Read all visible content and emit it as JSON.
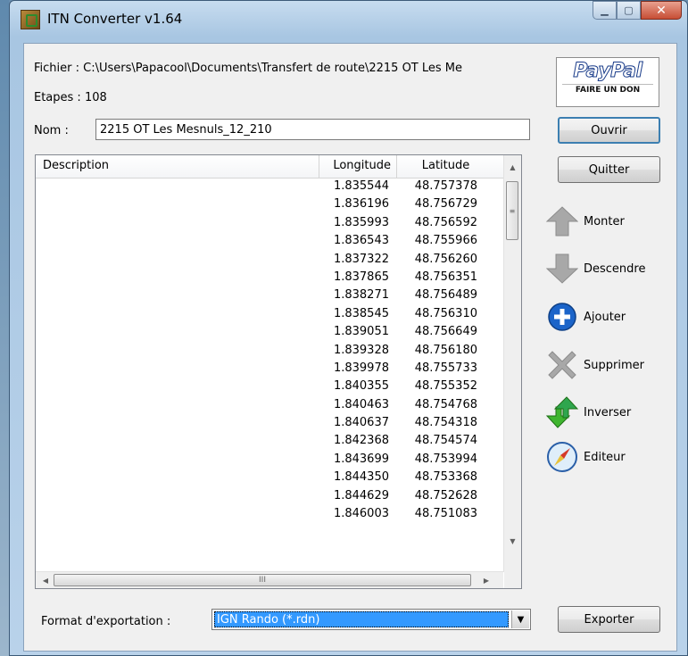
{
  "window": {
    "title": "ITN Converter v1.64"
  },
  "file": {
    "fichier_text": "Fichier : C:\\Users\\Papacool\\Documents\\Transfert de route\\2215 OT Les Me",
    "etapes_text": "Etapes : 108",
    "nom_label": "Nom :",
    "nom_value": "2215 OT Les Mesnuls_12_210"
  },
  "paypal": {
    "logo": "PayPal",
    "don": "FAIRE UN DON"
  },
  "buttons": {
    "ouvrir": "Ouvrir",
    "quitter": "Quitter",
    "monter": "Monter",
    "descendre": "Descendre",
    "ajouter": "Ajouter",
    "supprimer": "Supprimer",
    "inverser": "Inverser",
    "editeur": "Editeur",
    "exporter": "Exporter"
  },
  "table": {
    "columns": [
      "Description",
      "Longitude",
      "Latitude"
    ],
    "rows": [
      {
        "lon": "1.835544",
        "lat": "48.757378"
      },
      {
        "lon": "1.836196",
        "lat": "48.756729"
      },
      {
        "lon": "1.835993",
        "lat": "48.756592"
      },
      {
        "lon": "1.836543",
        "lat": "48.755966"
      },
      {
        "lon": "1.837322",
        "lat": "48.756260"
      },
      {
        "lon": "1.837865",
        "lat": "48.756351"
      },
      {
        "lon": "1.838271",
        "lat": "48.756489"
      },
      {
        "lon": "1.838545",
        "lat": "48.756310"
      },
      {
        "lon": "1.839051",
        "lat": "48.756649"
      },
      {
        "lon": "1.839328",
        "lat": "48.756180"
      },
      {
        "lon": "1.839978",
        "lat": "48.755733"
      },
      {
        "lon": "1.840355",
        "lat": "48.755352"
      },
      {
        "lon": "1.840463",
        "lat": "48.754768"
      },
      {
        "lon": "1.840637",
        "lat": "48.754318"
      },
      {
        "lon": "1.842368",
        "lat": "48.754574"
      },
      {
        "lon": "1.843699",
        "lat": "48.753994"
      },
      {
        "lon": "1.844350",
        "lat": "48.753368"
      },
      {
        "lon": "1.844629",
        "lat": "48.752628"
      },
      {
        "lon": "1.846003",
        "lat": "48.751083"
      }
    ]
  },
  "export": {
    "label": "Format d'exportation :",
    "selected": "IGN Rando (*.rdn)"
  },
  "icons": {
    "monter": "up-arrow-icon",
    "descendre": "down-arrow-icon",
    "ajouter": "add-circle-icon",
    "supprimer": "delete-x-icon",
    "inverser": "reverse-arrows-icon",
    "editeur": "compass-icon"
  },
  "colors": {
    "selection": "#3399ff",
    "close_button": "#c74e35",
    "paypal_blue": "#1a3c8a"
  }
}
